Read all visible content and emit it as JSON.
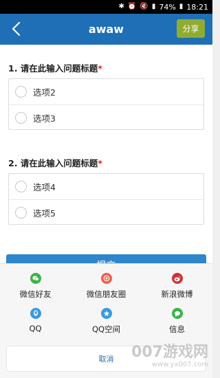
{
  "status_bar": {
    "battery": "74%",
    "time": "18:21"
  },
  "header": {
    "title": "awaw",
    "share_label": "分享"
  },
  "questions": [
    {
      "title": "1. 请在此输入问题标题",
      "required_mark": "*",
      "options": [
        "选项2",
        "选项3"
      ]
    },
    {
      "title": "2. 请在此输入问题标题",
      "required_mark": "*",
      "options": [
        "选项4",
        "选项5"
      ]
    }
  ],
  "submit_label": "提交",
  "share_sheet": {
    "items": [
      {
        "label": "微信好友",
        "icon": "wechat-icon",
        "color": "#3bb44a"
      },
      {
        "label": "微信朋友圈",
        "icon": "moments-icon",
        "color": "#e8604c"
      },
      {
        "label": "新浪微博",
        "icon": "weibo-icon",
        "color": "#d0303a"
      },
      {
        "label": "QQ",
        "icon": "qq-icon",
        "color": "#3a9ae0"
      },
      {
        "label": "QQ空间",
        "icon": "qzone-icon",
        "color": "#3a9ae0"
      },
      {
        "label": "信息",
        "icon": "message-icon",
        "color": "#3bb44a"
      }
    ],
    "cancel_label": "取消"
  },
  "watermark": {
    "main": "007游戏网",
    "sub": "www.yx007.com"
  },
  "colors": {
    "app_bar": "#1e6fb5",
    "share_button": "#8fac30",
    "submit_button": "#2f86cb",
    "required": "#d9232d"
  }
}
